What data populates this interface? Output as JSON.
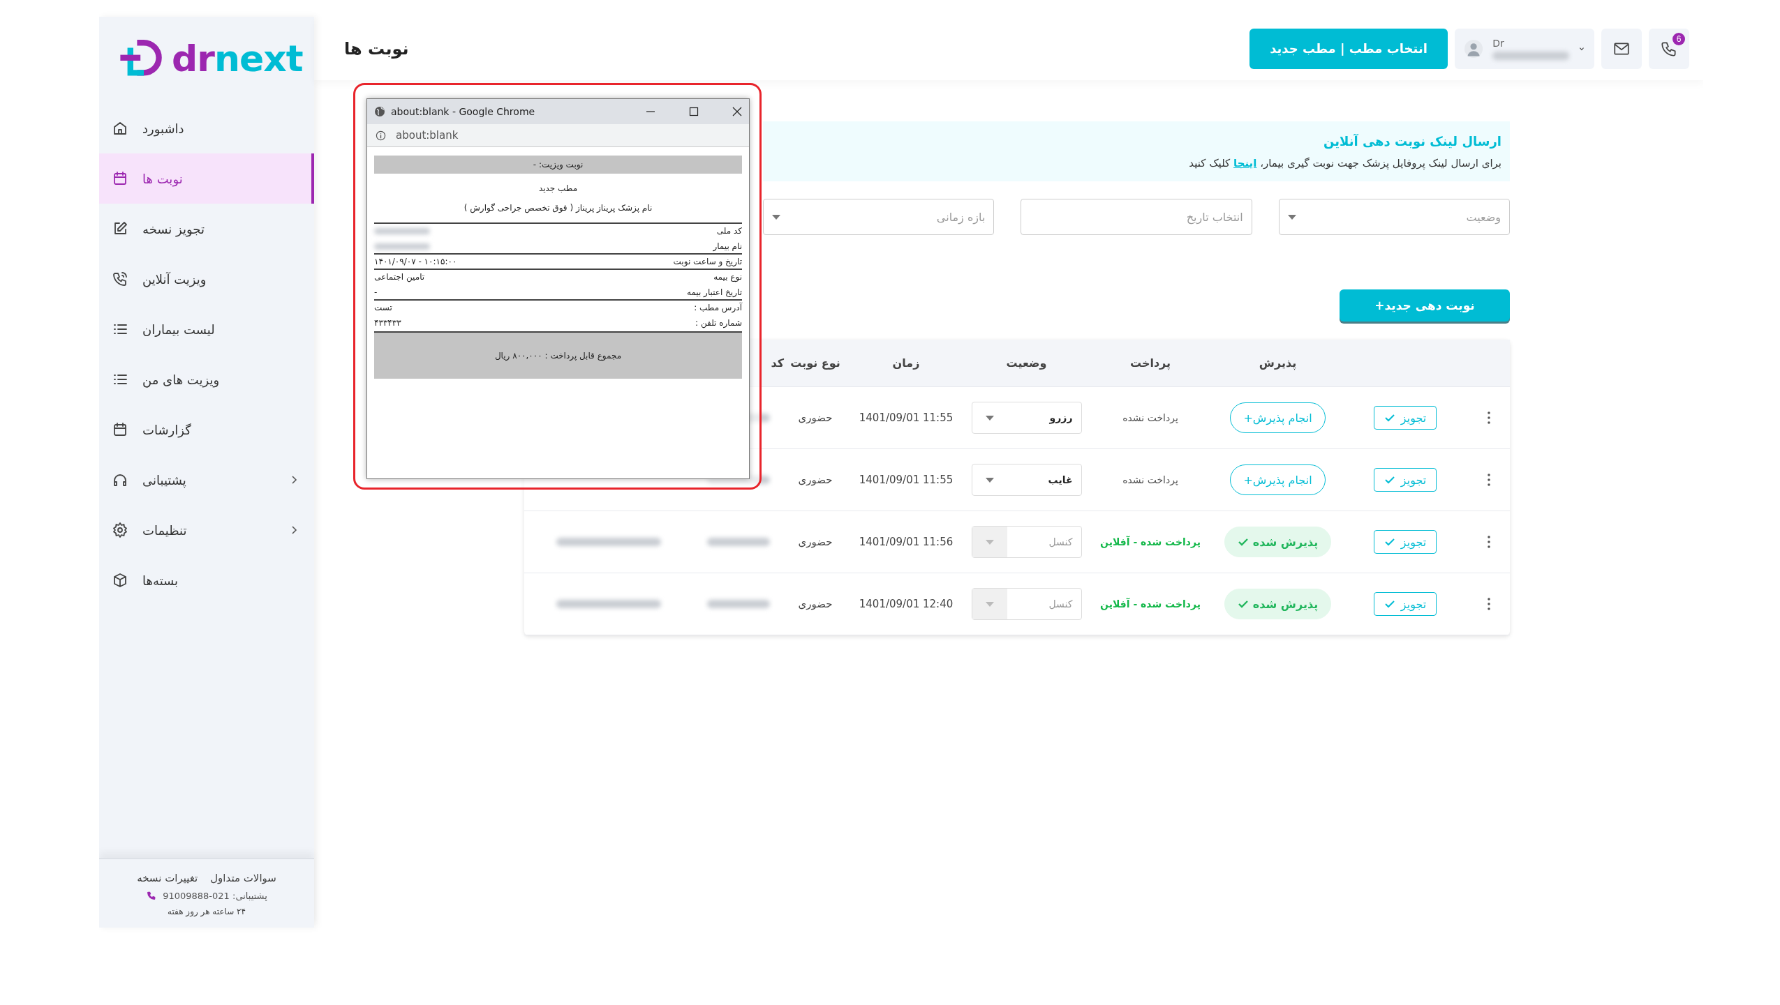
{
  "sidebar": {
    "logo": {
      "prefix": "dr",
      "suffix": "next"
    },
    "items": [
      {
        "label": "داشبورد",
        "kind": "home",
        "selected": false,
        "expandable": false
      },
      {
        "label": "نوبت ها",
        "kind": "calendar",
        "selected": true,
        "expandable": false
      },
      {
        "label": "تجویز نسخه",
        "kind": "edit",
        "selected": false,
        "expandable": false
      },
      {
        "label": "ویزیت آنلاین",
        "kind": "phone",
        "selected": false,
        "expandable": false
      },
      {
        "label": "لیست بیماران",
        "kind": "list",
        "selected": false,
        "expandable": false
      },
      {
        "label": "ویزیت های من",
        "kind": "list",
        "selected": false,
        "expandable": false
      },
      {
        "label": "گزارشات",
        "kind": "calendar",
        "selected": false,
        "expandable": false
      },
      {
        "label": "پشتیبانی",
        "kind": "headset",
        "selected": false,
        "expandable": true
      },
      {
        "label": "تنظیمات",
        "kind": "gear",
        "selected": false,
        "expandable": true
      },
      {
        "label": "بسته‌ها",
        "kind": "box",
        "selected": false,
        "expandable": false
      }
    ],
    "footer": {
      "links": [
        "سوالات متداول",
        "تغییرات نسخه"
      ],
      "support": "پشتیبانی: 021-91009888",
      "hours": "۲۴ ساعته هر روز هفته"
    }
  },
  "header": {
    "title": "نوبت ها",
    "clinic_button": "انتخاب مطب | مطب جدید",
    "profile": {
      "prefix": "Dr"
    },
    "notification_count": "6"
  },
  "link_box": {
    "title": "ارسال لینک نوبت دهی آنلاین",
    "text_before": "برای ارسال لینک پروفایل پزشک جهت نوبت گیری بیمار، ",
    "link": "اینجا",
    "text_after": " کلیک کنید"
  },
  "filters": [
    {
      "kind": "select",
      "placeholder": "وضعیت"
    },
    {
      "kind": "date",
      "placeholder": "انتخاب تاریخ"
    },
    {
      "kind": "select",
      "placeholder": "بازه زمانی"
    }
  ],
  "new_button": "نوبت دهی جدید+",
  "table": {
    "columns": [
      "پذیرش",
      "پرداخت",
      "وضعیت",
      "زمان",
      "نوع نوبت",
      "کد"
    ],
    "rows": [
      {
        "prescribe": "تجویز",
        "reception": {
          "label": "انجام پذیرش+",
          "done": false
        },
        "payment": {
          "label": "پرداخت نشده",
          "paid": false
        },
        "status": {
          "value": "رزرو",
          "disabled": false
        },
        "time": "1401/09/01 11:55",
        "visit_type": "حضوری"
      },
      {
        "prescribe": "تجویز",
        "reception": {
          "label": "انجام پذیرش+",
          "done": false
        },
        "payment": {
          "label": "پرداخت نشده",
          "paid": false
        },
        "status": {
          "value": "غایب",
          "disabled": false
        },
        "time": "1401/09/01 11:55",
        "visit_type": "حضوری"
      },
      {
        "prescribe": "تجویز",
        "reception": {
          "label": "پذیرش شده",
          "done": true
        },
        "payment": {
          "label": "پرداخت شده - آفلاین",
          "paid": true
        },
        "status": {
          "value": "کنسل",
          "disabled": true
        },
        "time": "1401/09/01 11:56",
        "visit_type": "حضوری"
      },
      {
        "prescribe": "تجویز",
        "reception": {
          "label": "پذیرش شده",
          "done": true
        },
        "payment": {
          "label": "پرداخت شده - آفلاین",
          "paid": true
        },
        "status": {
          "value": "کنسل",
          "disabled": true
        },
        "time": "1401/09/01 12:40",
        "visit_type": "حضوری"
      }
    ]
  },
  "popup": {
    "title": "about:blank - Google Chrome",
    "address": "about:blank",
    "receipt": {
      "heading": "نوبت ویزیت: -",
      "clinic": "مطب جدید",
      "doctor": "نام پزشک پریناز پریناز ( فوق تخصص جراحی گوارش )",
      "sections": [
        {
          "rows": [
            {
              "label": "کد ملی",
              "redacted": true
            },
            {
              "label": "نام بیمار",
              "redacted": true
            }
          ]
        },
        {
          "rows": [
            {
              "label": "تاریخ و ساعت نوبت",
              "value": "۱۴۰۱/۰۹/۰۷ - ۱۰:۱۵:۰۰",
              "redacted": false
            }
          ]
        },
        {
          "rows": [
            {
              "label": "نوع بیمه",
              "value": "تامین اجتماعی",
              "redacted": false
            },
            {
              "label": "تاریخ اعتبار بیمه",
              "value": "-",
              "redacted": false
            }
          ]
        },
        {
          "rows": [
            {
              "label": "آدرس مطب :",
              "value": "تست",
              "redacted": false
            },
            {
              "label": "شماره تلفن :",
              "value": "۴۳۳۴۳۳",
              "redacted": false
            }
          ]
        }
      ],
      "total": "مجموع قابل پرداخت : ۸۰۰,۰۰۰ ریال"
    }
  }
}
